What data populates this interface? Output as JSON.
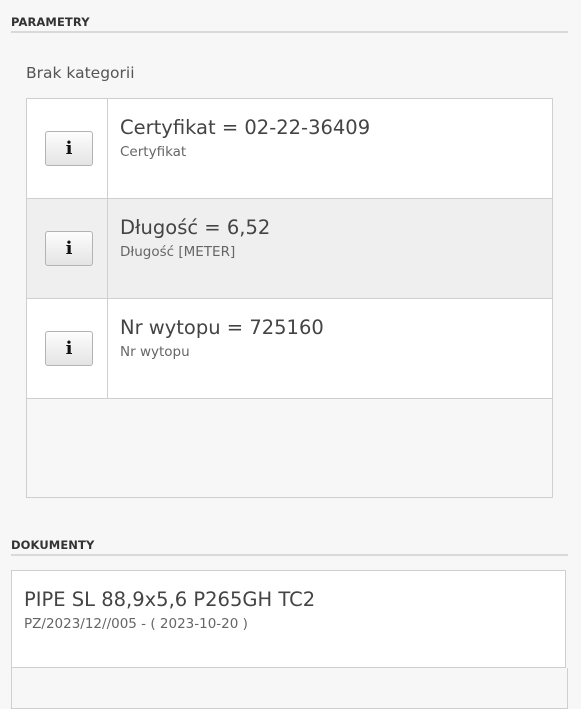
{
  "parameters": {
    "header": "PARAMETRY",
    "category": "Brak kategorii",
    "info_icon": "info-icon",
    "items": [
      {
        "title": "Certyfikat = 02-22-36409",
        "subtitle": "Certyfikat",
        "button_label": "i"
      },
      {
        "title": "Długość = 6,52",
        "subtitle": "Długość [METER]",
        "button_label": "i"
      },
      {
        "title": "Nr wytopu = 725160",
        "subtitle": "Nr wytopu",
        "button_label": "i"
      }
    ]
  },
  "documents": {
    "header": "DOKUMENTY",
    "items": [
      {
        "title": "PIPE SL 88,9x5,6 P265GH TC2",
        "subtitle": "PZ/2023/12//005 - ( 2023-10-20 )"
      }
    ]
  }
}
